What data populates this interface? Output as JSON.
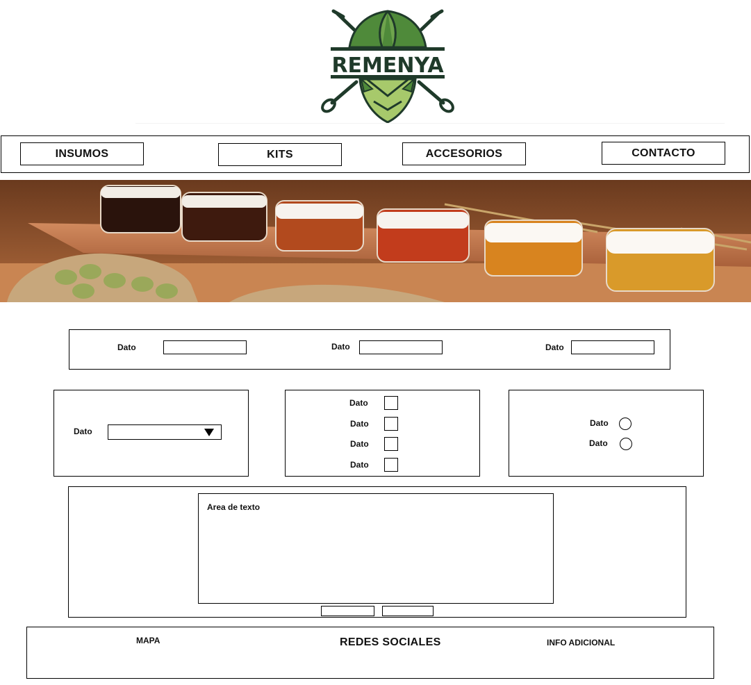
{
  "brand": {
    "name": "REMENYA"
  },
  "nav": {
    "items": [
      {
        "label": "INSUMOS"
      },
      {
        "label": "KITS"
      },
      {
        "label": "ACCESORIOS"
      },
      {
        "label": "CONTACTO"
      }
    ]
  },
  "form": {
    "row1": {
      "fields": [
        {
          "label": "Dato"
        },
        {
          "label": "Dato"
        },
        {
          "label": "Dato"
        }
      ]
    },
    "select": {
      "label": "Dato"
    },
    "checkboxes": [
      {
        "label": "Dato"
      },
      {
        "label": "Dato"
      },
      {
        "label": "Dato"
      },
      {
        "label": "Dato"
      }
    ],
    "radios": [
      {
        "label": "Dato"
      },
      {
        "label": "Dato"
      }
    ],
    "textarea": {
      "label": "Area de texto"
    }
  },
  "footer": {
    "map": "MAPA",
    "social": "REDES SOCIALES",
    "info": "INFO ADICIONAL"
  },
  "colors": {
    "logo_dark": "#1f3a2a",
    "hop_green": "#4f8a3a",
    "hop_light": "#a7c96b",
    "wood": "#b9704a"
  }
}
